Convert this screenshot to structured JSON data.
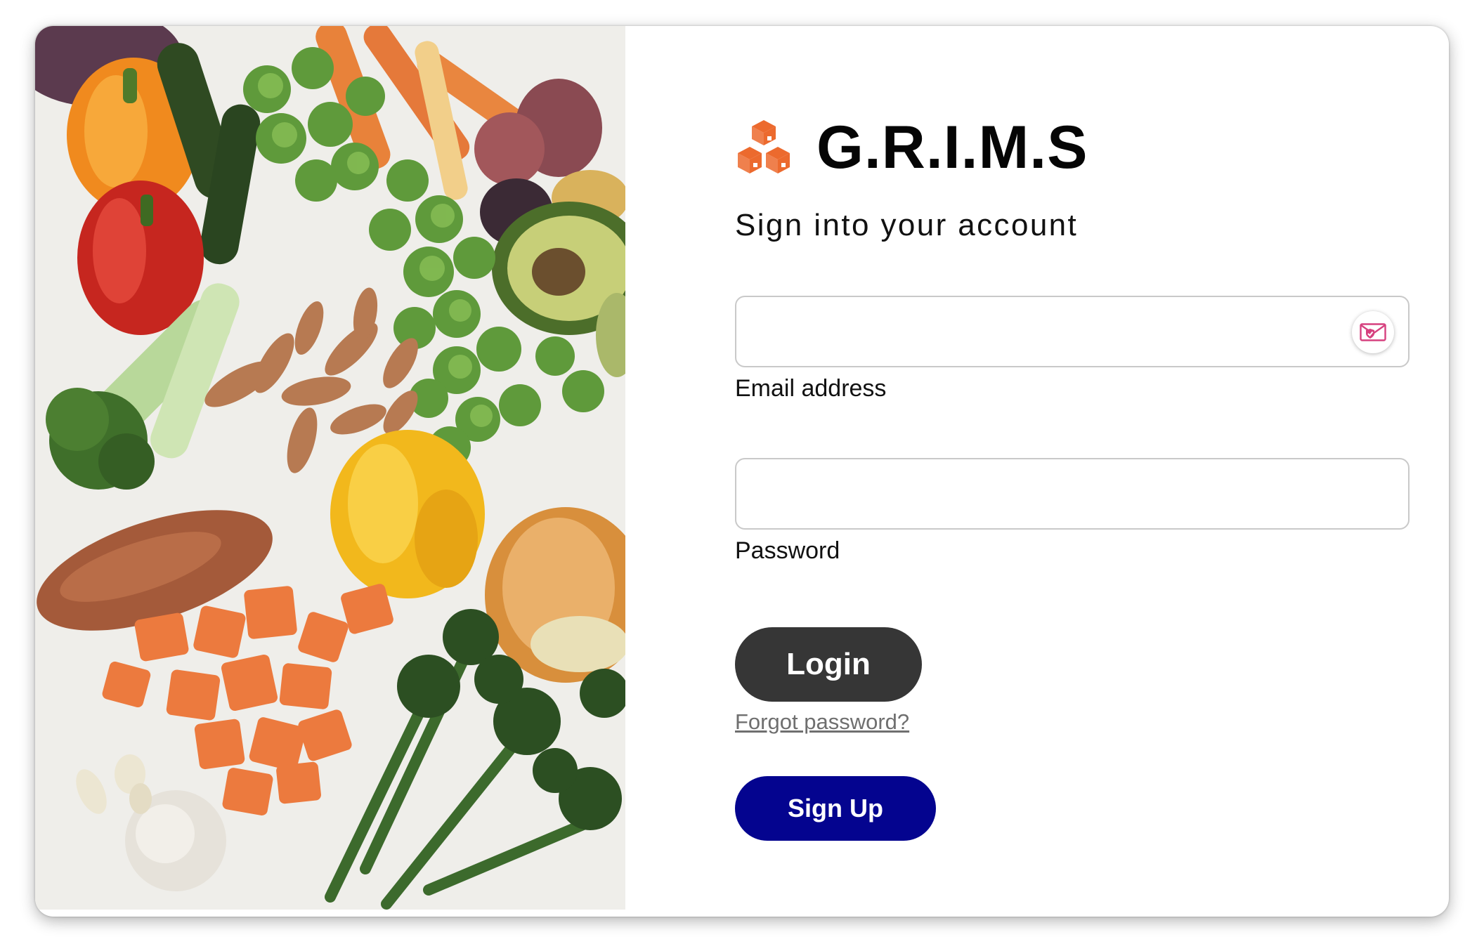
{
  "brand": {
    "name": "G.R.I.M.S",
    "icon": "boxes-icon",
    "icon_color": "#EC6A2E"
  },
  "hero_image": {
    "subject": "fresh-vegetables-photo"
  },
  "form": {
    "subtitle": "Sign into your account",
    "email": {
      "label": "Email address",
      "value": "",
      "placeholder": "",
      "badge_icon": "secure-mail-icon",
      "badge_color": "#D6417F"
    },
    "password": {
      "label": "Password",
      "value": "",
      "placeholder": ""
    },
    "login_label": "Login",
    "forgot_label": "Forgot password?",
    "signup_label": "Sign Up"
  },
  "colors": {
    "login_button": "#363636",
    "signup_button": "#04048F",
    "forgot_link": "#6F6F6F",
    "input_border": "#C9C9C9"
  }
}
